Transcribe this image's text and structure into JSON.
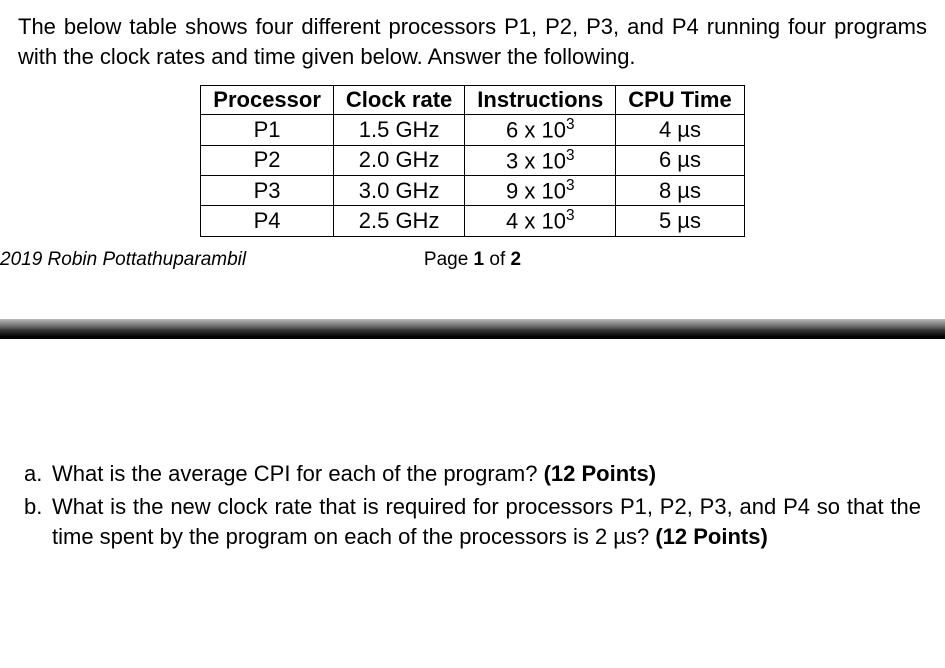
{
  "intro": "The below table shows four different processors P1, P2, P3, and P4 running four programs with the clock rates and time given below. Answer the following.",
  "table": {
    "headers": [
      "Processor",
      "Clock rate",
      "Instructions",
      "CPU Time"
    ],
    "rows": [
      {
        "processor": "P1",
        "clock": "1.5 GHz",
        "instr_base": "6 x 10",
        "instr_exp": "3",
        "time": "4 µs"
      },
      {
        "processor": "P2",
        "clock": "2.0 GHz",
        "instr_base": "3 x 10",
        "instr_exp": "3",
        "time": "6 µs"
      },
      {
        "processor": "P3",
        "clock": "3.0 GHz",
        "instr_base": "9 x 10",
        "instr_exp": "3",
        "time": "8 µs"
      },
      {
        "processor": "P4",
        "clock": "2.5 GHz",
        "instr_base": "4 x 10",
        "instr_exp": "3",
        "time": "5 µs"
      }
    ]
  },
  "footer": {
    "left": "2019 Robin Pottathuparambil",
    "center_prefix": "Page ",
    "center_num": "1",
    "center_of": " of ",
    "center_total": "2"
  },
  "questions": {
    "a": {
      "marker": "a.",
      "text": "What is the average CPI for each of the program? ",
      "points": "(12 Points)"
    },
    "b": {
      "marker": "b.",
      "text1": "What is the new clock rate that is required for processors P1, P2, P3, and P4 so that the time spent by the program on each of the processors is 2 µs? ",
      "points": "(12 Points)"
    }
  }
}
